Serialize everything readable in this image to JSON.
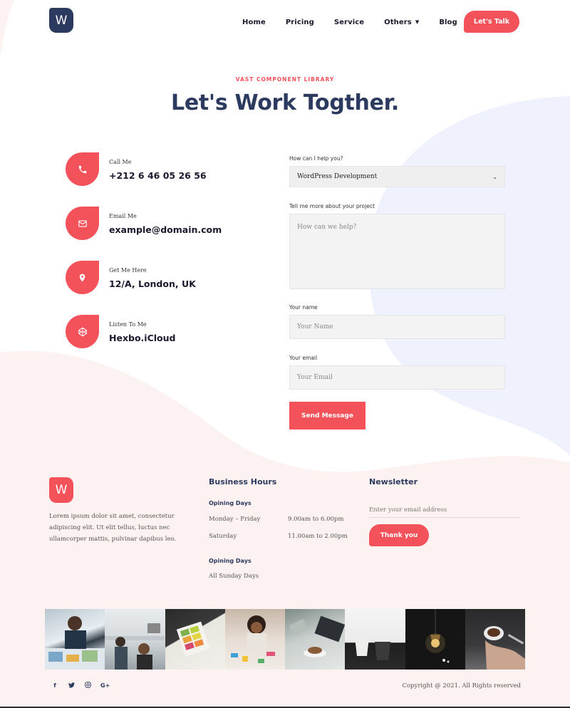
{
  "header": {
    "logo_letter": "W",
    "nav": [
      "Home",
      "Pricing",
      "Service",
      "Others",
      "Blog"
    ],
    "cta_label": "Let's Talk"
  },
  "hero": {
    "eyebrow": "VAST COMPONENT LIBRARY",
    "title": "Let's Work Togther."
  },
  "contacts": [
    {
      "label": "Call Me",
      "value": "+212 6 46 05 26 56",
      "icon": "phone-icon"
    },
    {
      "label": "Email Me",
      "value": "example@domain.com",
      "icon": "mail-icon"
    },
    {
      "label": "Get Me Here",
      "value": "12/A, London, UK",
      "icon": "location-icon"
    },
    {
      "label": "Listen To Me",
      "value": "Hexbo.iCloud",
      "icon": "codepen-icon"
    }
  ],
  "form": {
    "help_label": "How can I help you?",
    "help_selected": "WordPress Development",
    "project_label": "Tell me more about your project",
    "project_placeholder": "How can we help?",
    "name_label": "Your name",
    "name_placeholder": "Your Name",
    "email_label": "Your email",
    "email_placeholder": "Your Email",
    "submit_label": "Send Message"
  },
  "footer": {
    "logo_letter": "W",
    "about": "Lorem ipsum dolor sit amet, consectetur adipiscing elit. Ut elit tellus, luctus nec ullamcorper mattis, pulvinar dapibus leo.",
    "business_title": "Business Hours",
    "open_title_1": "Opining Days",
    "hours": [
      {
        "day": "Monday – Friday",
        "time": "9.00am to 6.00pm"
      },
      {
        "day": "Saturday",
        "time": "11.00am to 2.00pm"
      }
    ],
    "open_title_2": "Opining Days",
    "sunday": "All Sunday Days",
    "newsletter_title": "Newsletter",
    "newsletter_placeholder": "Enter your email address",
    "newsletter_button": "Thank you",
    "socials": [
      "facebook-icon",
      "twitter-icon",
      "instagram-icon",
      "google-plus-icon"
    ],
    "copyright": "Copyright @ 2021. All Rights reserved"
  },
  "colors": {
    "accent": "#f4525a",
    "navy": "#2b3a5e",
    "blob_blue": "#eff1fd",
    "blob_pink": "#fdf2f2"
  },
  "gallery": [
    "kids-drawing-photo",
    "office-people-photo",
    "color-swatches-photo",
    "child-crafts-photo",
    "coffee-laptop-photo",
    "coffee-cups-photo",
    "lamp-dark-photo",
    "espresso-cup-photo"
  ]
}
